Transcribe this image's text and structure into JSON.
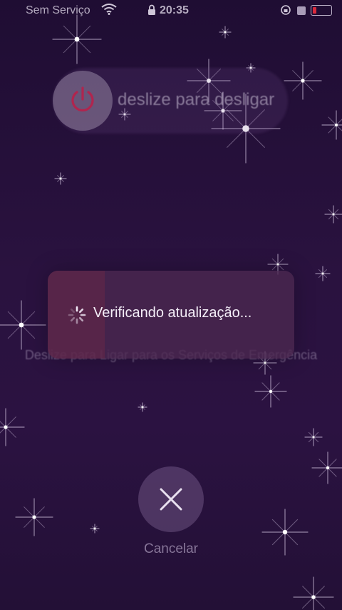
{
  "status_bar": {
    "carrier": "Sem Serviço",
    "time": "20:35"
  },
  "power_slider": {
    "label": "deslize para desligar"
  },
  "sos_hint": "Deslize para Ligar para os Serviços de Emergência",
  "update_dialog": {
    "message": "Verificando atualização..."
  },
  "cancel": {
    "label": "Cancelar"
  },
  "colors": {
    "power_icon": "#b0254e",
    "battery_low": "#d92a3c"
  },
  "icons": [
    "wifi-icon",
    "lock-icon",
    "orientation-lock-icon",
    "battery-icon",
    "power-icon",
    "spinner-icon",
    "close-icon"
  ]
}
